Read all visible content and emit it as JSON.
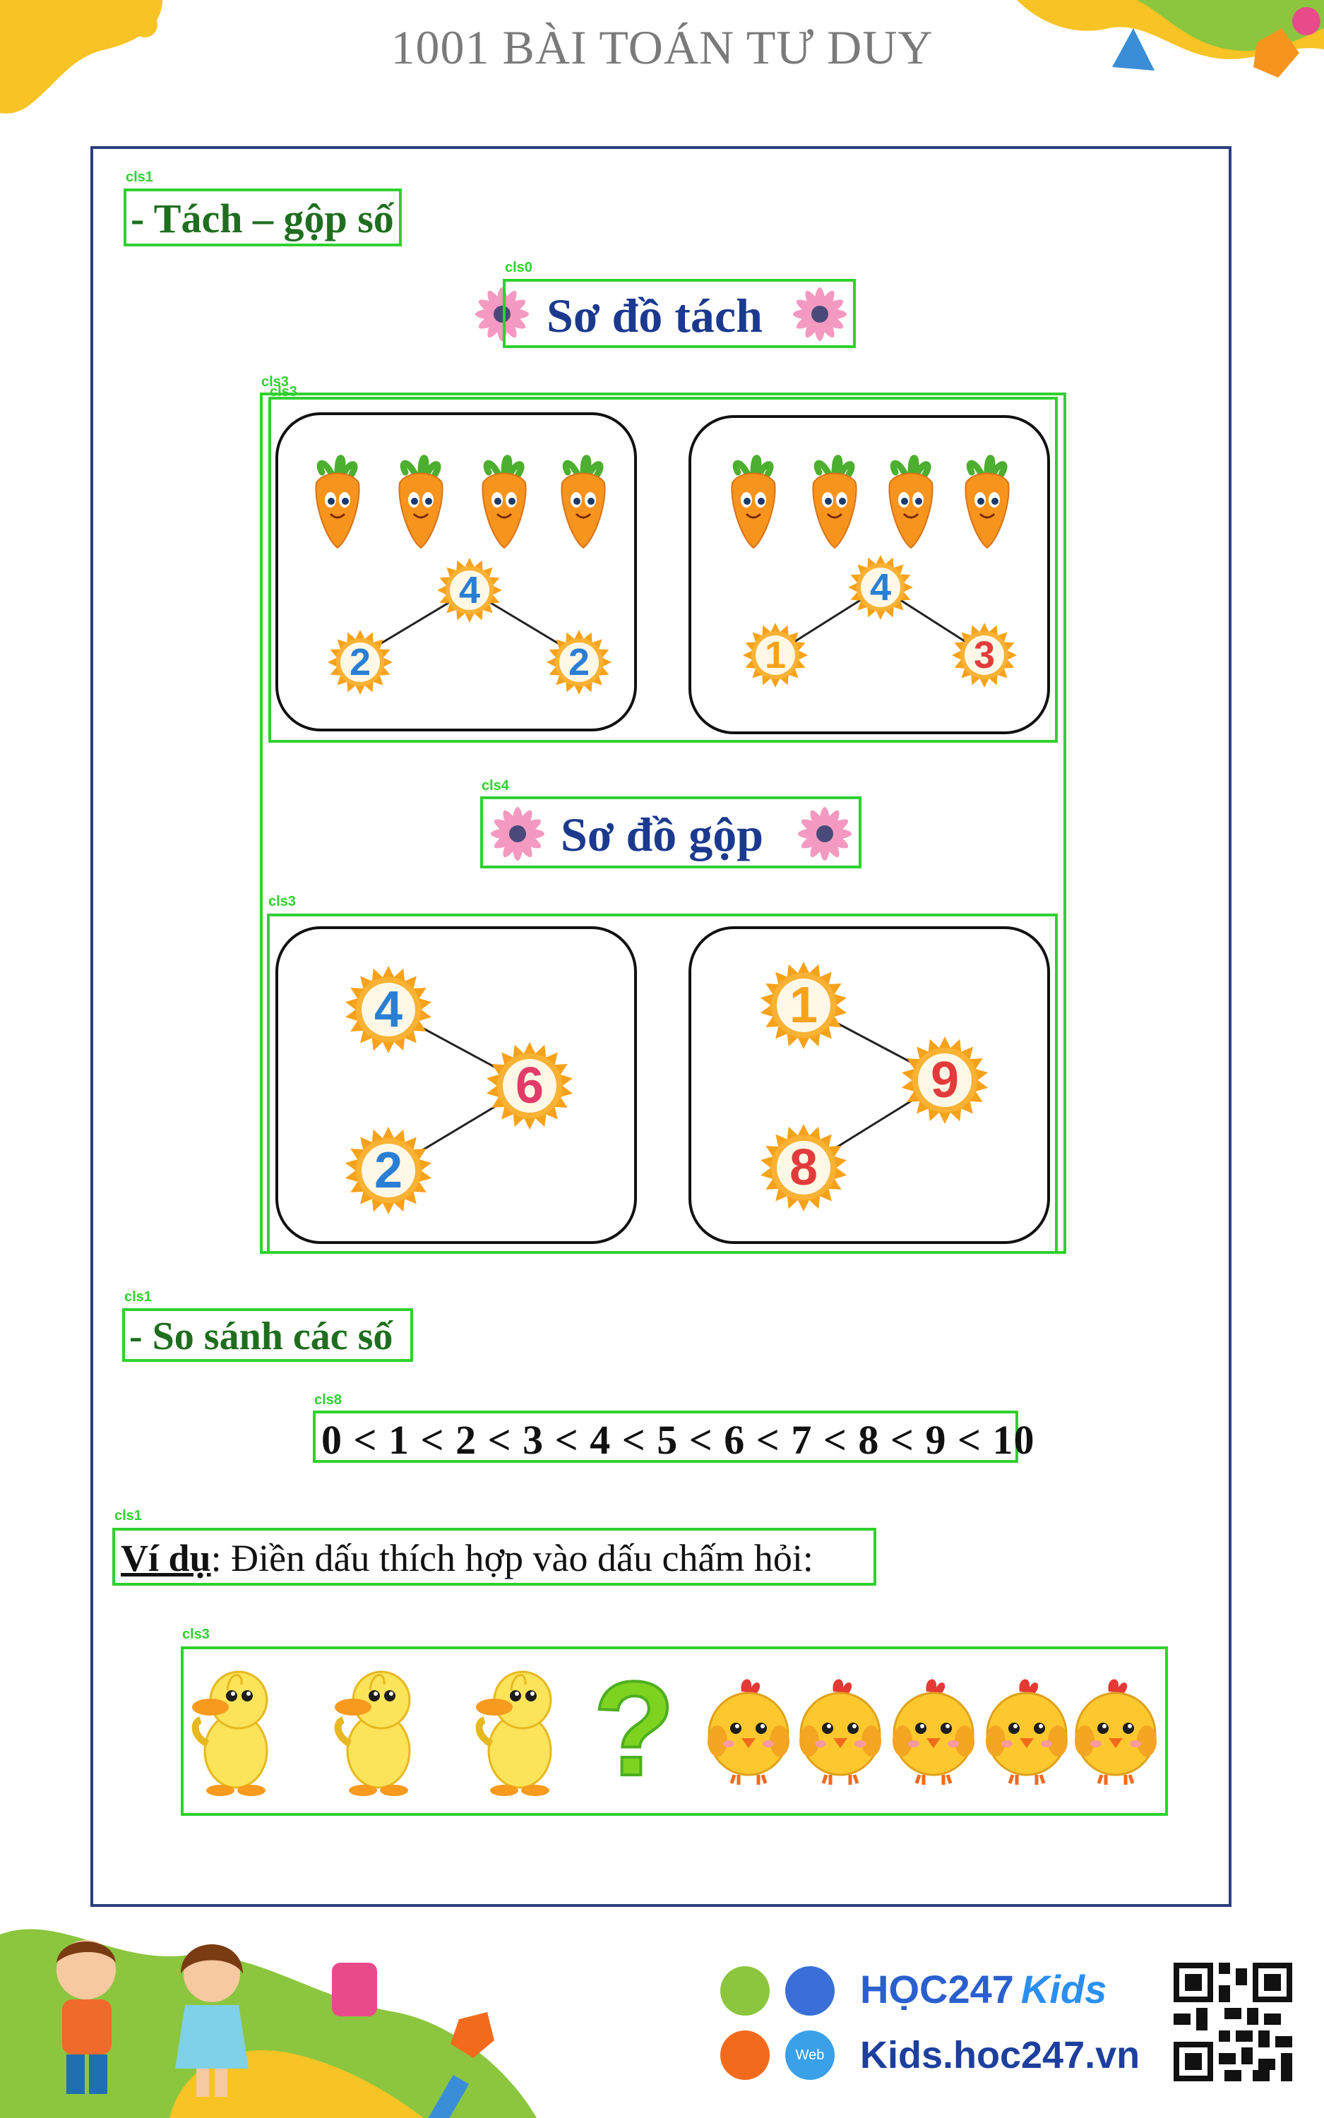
{
  "header": {
    "title": "1001 BÀI TOÁN TƯ DUY"
  },
  "tags": {
    "t1": "cls1",
    "t0": "cls0",
    "t3a": "cls3",
    "t3b": "cls3",
    "t4": "cls4",
    "t3c": "cls3",
    "t1b": "cls1",
    "t8": "cls8",
    "t1c": "cls1",
    "t3d": "cls3"
  },
  "section1": {
    "heading": "- Tách – gộp số"
  },
  "split": {
    "title": "Sơ đồ tách",
    "cards": [
      {
        "total": "4",
        "left": "2",
        "right": "2"
      },
      {
        "total": "4",
        "left": "1",
        "right": "3"
      }
    ]
  },
  "merge": {
    "title": "Sơ đồ gộp",
    "cards": [
      {
        "top": "4",
        "bottom": "2",
        "sum": "6"
      },
      {
        "top": "1",
        "bottom": "8",
        "sum": "9"
      }
    ]
  },
  "section2": {
    "heading": "- So sánh các số"
  },
  "sequence": "0 < 1 < 2 < 3 < 4 < 5 < 6 < 7 < 8 < 9 < 10",
  "example": {
    "label": "Ví dụ",
    "text": ": Điền dấu thích hợp vào dấu chấm hỏi:"
  },
  "example_row": {
    "question": "?",
    "ducks": 3,
    "chicks": 5
  },
  "footer": {
    "brand": "HỌC247",
    "brand_kids": "Kids",
    "site": "Kids.hoc247.vn",
    "web_badge": "Web"
  },
  "colors": {
    "accent_green": "#2fd12f",
    "title_blue": "#1b3a8f",
    "heading_green": "#1f6e1f",
    "frame": "#2b3f7e"
  }
}
